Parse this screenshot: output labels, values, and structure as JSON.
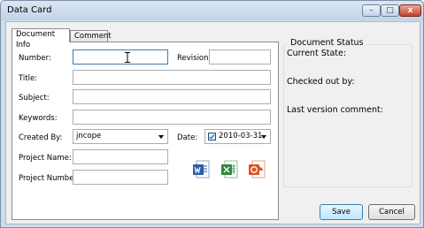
{
  "window": {
    "title": "Data Card",
    "controls": {
      "minimize": "–",
      "maximize": "□",
      "close": "x"
    }
  },
  "tabs": [
    {
      "label": "Document Info",
      "active": true
    },
    {
      "label": "Comment",
      "active": false
    }
  ],
  "form": {
    "number": {
      "label": "Number:",
      "value": ""
    },
    "revision": {
      "label": "Revision:",
      "value": ""
    },
    "title": {
      "label": "Title:",
      "value": ""
    },
    "subject": {
      "label": "Subject:",
      "value": ""
    },
    "keywords": {
      "label": "Keywords:",
      "value": ""
    },
    "created_by": {
      "label": "Created By:",
      "value": "jncope"
    },
    "date": {
      "label": "Date:",
      "value": "2010-03-31",
      "checked": true
    },
    "project_name": {
      "label": "Project Name:",
      "value": ""
    },
    "project_number": {
      "label": "Project Number:",
      "value": ""
    }
  },
  "file_icons": [
    "word-document-icon",
    "excel-workbook-icon",
    "powerpoint-presentation-icon"
  ],
  "status": {
    "group_title": "Document Status",
    "current_state": "Current State:",
    "checked_out_by": "Checked out by:",
    "last_version_comment": "Last version comment:"
  },
  "buttons": {
    "save": "Save",
    "cancel": "Cancel"
  },
  "colors": {
    "word": "#2f5aa8",
    "excel": "#2e8a3a",
    "powerpoint": "#d9522b",
    "focus_border": "#3d7bad"
  }
}
